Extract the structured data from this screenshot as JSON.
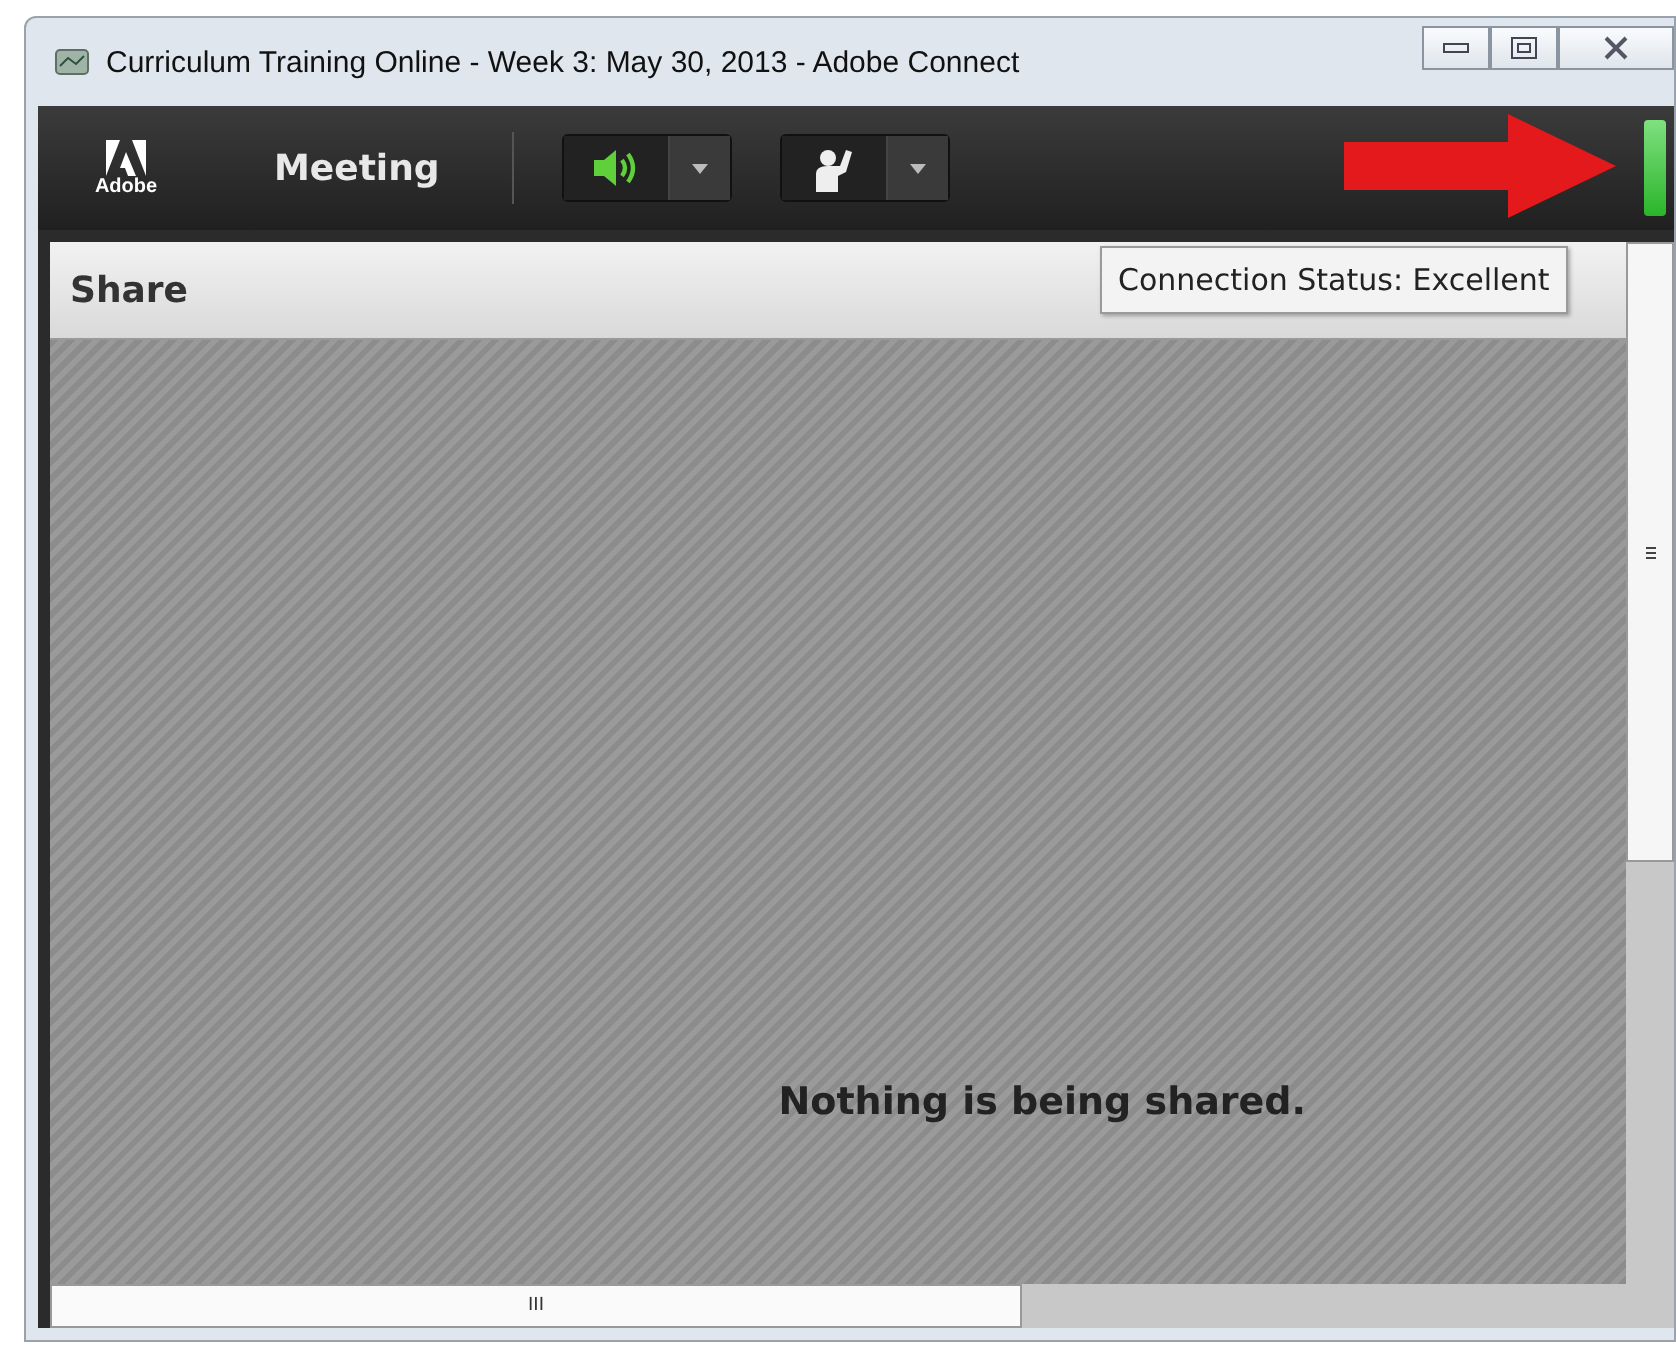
{
  "window": {
    "title": "Curriculum Training Online - Week 3: May 30, 2013 - Adobe Connect"
  },
  "toolbar": {
    "logo": "Adobe",
    "menu": "Meeting"
  },
  "tooltip": "Connection Status: Excellent",
  "share_pod": {
    "title": "Share",
    "message": "Nothing is being shared."
  },
  "horizontal_scrollbar": {
    "grip": "III"
  }
}
